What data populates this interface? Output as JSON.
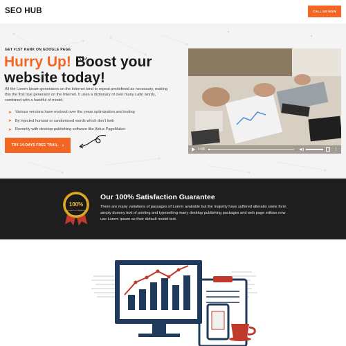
{
  "header": {
    "logo": "SEO HUB",
    "call_button": "CALL US NOW"
  },
  "hero": {
    "rank_label": "GET #1ST RANK ON GOOGLE PAGE",
    "headline_accent": "Hurry Up!",
    "headline_rest": " Boost your website today!",
    "description": "All the Lorem Ipsum generators on the Internet tend to repeat predefined as necessary, making this the first true generator on the Internet. It uses a dictionary of over many Latin words, combined with a handful of model.",
    "bullets": [
      "Various versions have evolved over the years optimization and testing",
      "By injected humour or randomised words which don't look",
      "Recently with desktop publishing software like Aldus PageMaker"
    ],
    "trial_button": "TRY 14-DAYS FREE TRAIL",
    "trial_arrow_icon": "chevron-right-icon",
    "accent_color": "#f26522"
  },
  "video": {
    "time": "1:08",
    "progress": 0.02
  },
  "guarantee": {
    "badge_top": "100%",
    "badge_bottom": "SATISFACTION GUARANTEE",
    "title": "Our 100% Satisfaction Guarantee",
    "text": "There are many variations of passages of Lorem available but the majority have suffered alteratio some form simply dummy text of printing and typesetting many desktop publishing packages and web page editors now use Lorem Ipsum as their default model text."
  }
}
